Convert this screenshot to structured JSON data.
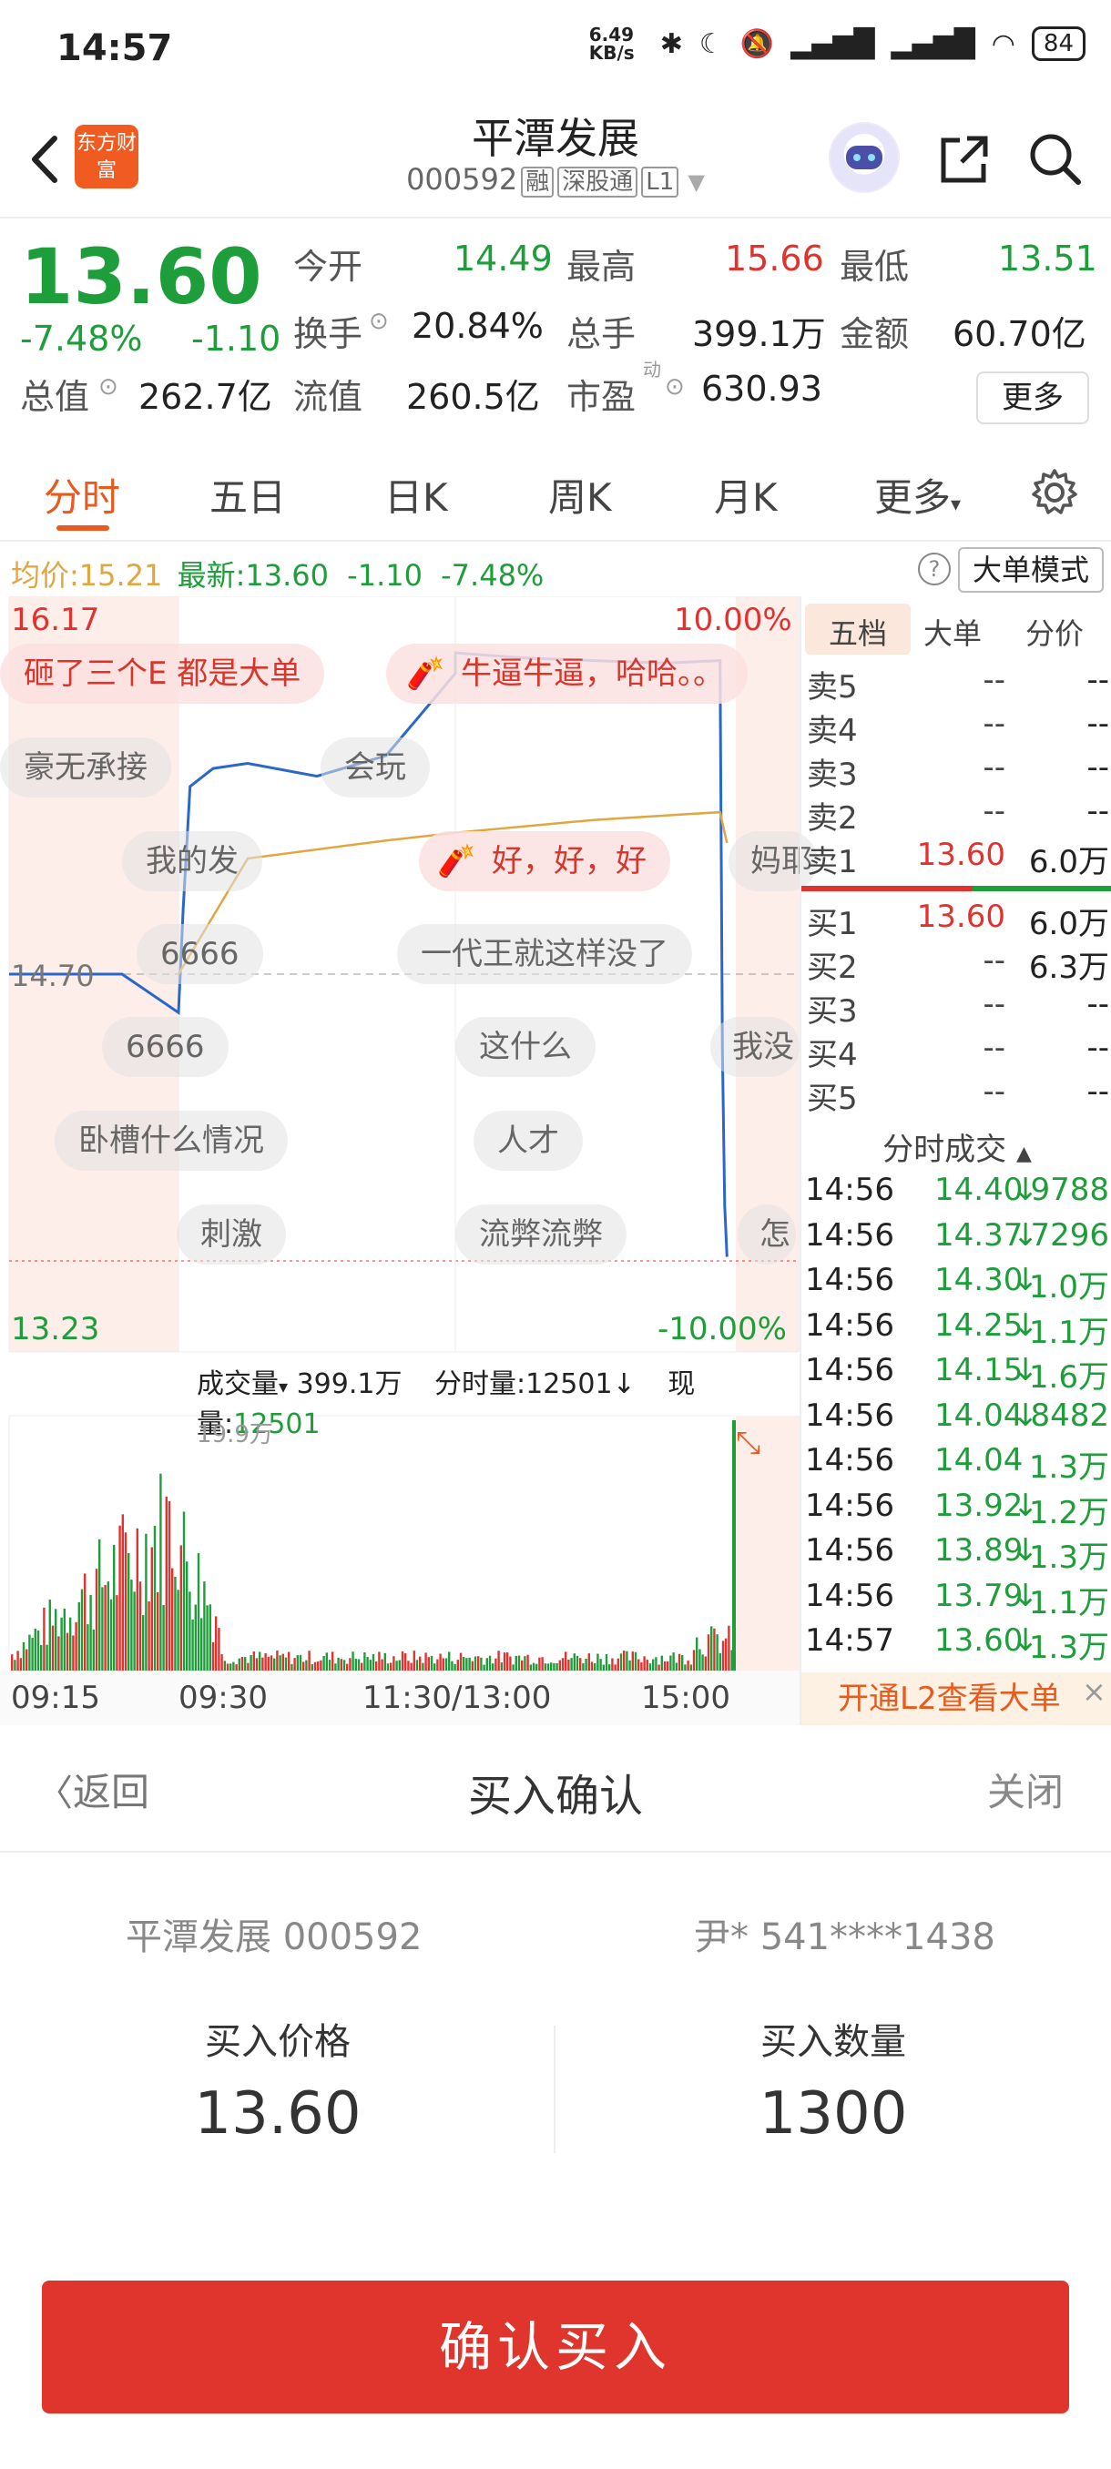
{
  "status_bar": {
    "time": "14:57",
    "net_speed": "6.49 KB/s",
    "battery": "84"
  },
  "header": {
    "logo": "东方财富",
    "title": "平潭发展",
    "code": "000592",
    "tags": [
      "融",
      "深股通",
      "L1"
    ]
  },
  "quote": {
    "price": "13.60",
    "change_pct": "-7.48%",
    "change_amt": "-1.10",
    "open_label": "今开",
    "open": "14.49",
    "high_label": "最高",
    "high": "15.66",
    "low_label": "最低",
    "low": "13.51",
    "turnover_label": "换手",
    "turnover": "20.84%",
    "volume_label": "总手",
    "volume": "399.1万",
    "amount_label": "金额",
    "amount": "60.70亿",
    "mcap_label": "总值",
    "mcap": "262.7亿",
    "float_label": "流值",
    "float": "260.5亿",
    "pe_label": "市盈",
    "pe_sup": "动",
    "pe": "630.93",
    "more": "更多"
  },
  "tabs": [
    "分时",
    "五日",
    "日K",
    "周K",
    "月K",
    "更多"
  ],
  "info_line": {
    "avg_label": "均价:",
    "avg": "15.21",
    "latest_label": "最新:",
    "latest": "13.60",
    "chg": "-1.10",
    "pct": "-7.48%",
    "big_mode": "大单模式"
  },
  "chart": {
    "top_price": "16.17",
    "top_pct": "10.00%",
    "mid_price": "14.70",
    "bottom_price": "13.23",
    "bottom_pct": "-10.00%",
    "vol_selector": "成交量",
    "vol_total": "399.1万",
    "vol_minute": "分时量:12501↓",
    "vol_now_label": "现量:",
    "vol_now": "12501",
    "vol_max": "19.9万",
    "x_labels": [
      "09:15",
      "09:30",
      "11:30/13:00",
      "15:00"
    ]
  },
  "chart_data": {
    "type": "line",
    "title": "",
    "series": [
      {
        "name": "",
        "x": [
          "09:15",
          "09:25",
          "09:30",
          "09:32",
          "09:35",
          "09:45",
          "10:00",
          "10:30",
          "11:00",
          "11:30",
          "13:00",
          "13:30",
          "14:00",
          "14:30",
          "14:54",
          "14:55",
          "14:56",
          "14:57"
        ],
        "values": [
          14.7,
          14.7,
          14.55,
          14.95,
          15.43,
          15.5,
          15.52,
          15.47,
          15.55,
          15.87,
          15.95,
          15.93,
          15.92,
          15.91,
          15.92,
          14.4,
          13.8,
          13.6
        ]
      },
      {
        "name": "均价",
        "x": [
          "09:30",
          "10:00",
          "11:00",
          "13:00",
          "14:00",
          "14:54",
          "14:57"
        ],
        "values": [
          14.7,
          15.15,
          15.22,
          15.25,
          15.3,
          15.33,
          15.21
        ]
      }
    ],
    "ylim": [
      13.23,
      16.17
    ],
    "ylabel_right": [
      "10.00%",
      "-10.00%"
    ]
  },
  "danmu": [
    {
      "text": "砸了三个E 都是大单",
      "hot": true
    },
    {
      "text": "牛逼牛逼，哈哈。。",
      "hot": true
    },
    {
      "text": "豪无承接",
      "hot": false
    },
    {
      "text": "会玩",
      "hot": false
    },
    {
      "text": "我的发",
      "hot": false
    },
    {
      "text": "好，好，好",
      "hot": true
    },
    {
      "text": "妈耶",
      "hot": false
    },
    {
      "text": "6666",
      "hot": false
    },
    {
      "text": "一代王就这样没了",
      "hot": false
    },
    {
      "text": "6666",
      "hot": false
    },
    {
      "text": "这什么",
      "hot": false
    },
    {
      "text": "我没",
      "hot": false
    },
    {
      "text": "卧槽什么情况",
      "hot": false
    },
    {
      "text": "人才",
      "hot": false
    },
    {
      "text": "刺激",
      "hot": false
    },
    {
      "text": "流弊流弊",
      "hot": false
    },
    {
      "text": "怎",
      "hot": false
    }
  ],
  "orderbook": {
    "tabs": [
      "五档",
      "大单",
      "分价"
    ],
    "asks": [
      {
        "label": "卖5",
        "price": "--",
        "vol": "--"
      },
      {
        "label": "卖4",
        "price": "--",
        "vol": "--"
      },
      {
        "label": "卖3",
        "price": "--",
        "vol": "--"
      },
      {
        "label": "卖2",
        "price": "--",
        "vol": "--"
      },
      {
        "label": "卖1",
        "price": "13.60",
        "vol": "6.0万"
      }
    ],
    "bids": [
      {
        "label": "买1",
        "price": "13.60",
        "vol": "6.0万"
      },
      {
        "label": "买2",
        "price": "--",
        "vol": "6.3万"
      },
      {
        "label": "买3",
        "price": "--",
        "vol": "--"
      },
      {
        "label": "买4",
        "price": "--",
        "vol": "--"
      },
      {
        "label": "买5",
        "price": "--",
        "vol": "--"
      }
    ],
    "ticks_title": "分时成交",
    "ticks": [
      {
        "time": "14:56",
        "price": "14.40",
        "dir": "↓",
        "vol": "9788"
      },
      {
        "time": "14:56",
        "price": "14.37",
        "dir": "↓",
        "vol": "7296"
      },
      {
        "time": "14:56",
        "price": "14.30",
        "dir": "↓",
        "vol": "1.0万"
      },
      {
        "time": "14:56",
        "price": "14.25",
        "dir": "↓",
        "vol": "1.1万"
      },
      {
        "time": "14:56",
        "price": "14.15",
        "dir": "↓",
        "vol": "1.6万"
      },
      {
        "time": "14:56",
        "price": "14.04",
        "dir": "↓",
        "vol": "8482"
      },
      {
        "time": "14:56",
        "price": "14.04",
        "dir": "",
        "vol": "1.3万"
      },
      {
        "time": "14:56",
        "price": "13.92",
        "dir": "↓",
        "vol": "1.2万"
      },
      {
        "time": "14:56",
        "price": "13.89",
        "dir": "↓",
        "vol": "1.3万"
      },
      {
        "time": "14:56",
        "price": "13.79",
        "dir": "↓",
        "vol": "1.1万"
      },
      {
        "time": "14:57",
        "price": "13.60",
        "dir": "↓",
        "vol": "1.3万"
      }
    ],
    "l2_banner": "开通L2查看大单"
  },
  "sheet": {
    "back": "返回",
    "title": "买入确认",
    "close": "关闭",
    "stock": "平潭发展 000592",
    "account": "尹* 541****1438",
    "price_label": "买入价格",
    "price": "13.60",
    "qty_label": "买入数量",
    "qty": "1300",
    "confirm": "确认买入"
  },
  "colors": {
    "up": "#e0332f",
    "down": "#1e9e3a",
    "accent": "#e85a1d",
    "price_line": "#2a67c9",
    "avg_line": "#e0a640",
    "confirm_bg": "#e0352d"
  }
}
